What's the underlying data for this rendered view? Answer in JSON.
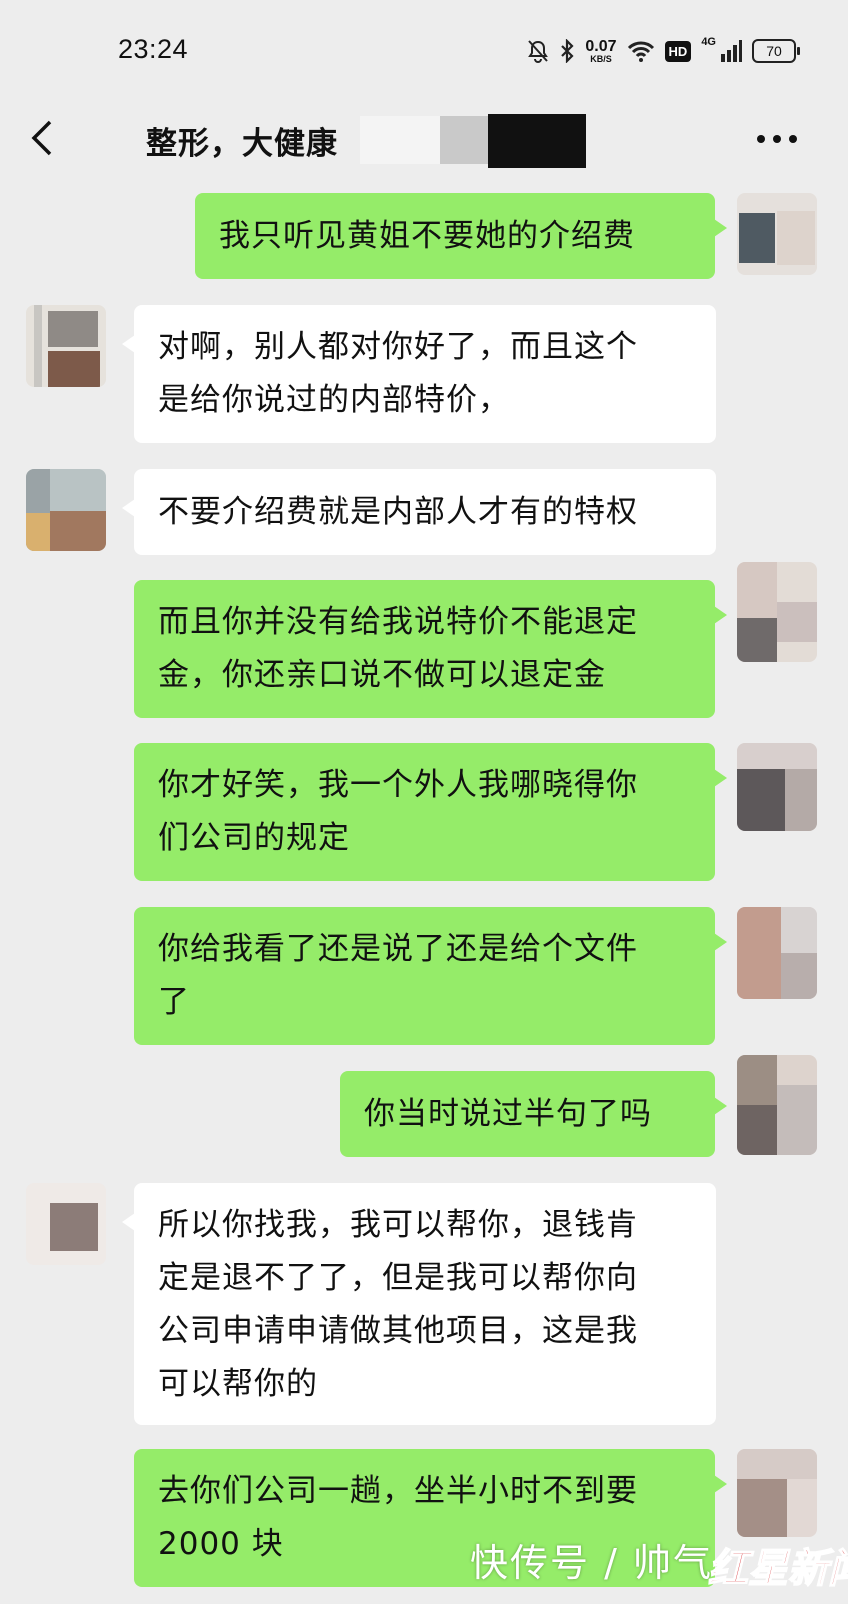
{
  "status_bar": {
    "time": "23:24",
    "net_speed_value": "0.07",
    "net_speed_unit": "KB/S",
    "hd_badge": "HD",
    "network_type": "4G",
    "battery_level": "70"
  },
  "header": {
    "title": "整形，大健康"
  },
  "messages": [
    {
      "from": "me",
      "text": "我只听见黄姐不要她的介绍费"
    },
    {
      "from": "other",
      "text": "对啊，别人都对你好了，而且这个\n是给你说过的内部特价，"
    },
    {
      "from": "other",
      "text": "不要介绍费就是内部人才有的特权"
    },
    {
      "from": "me",
      "text": "而且你并没有给我说特价不能退定\n金，你还亲口说不做可以退定金"
    },
    {
      "from": "me",
      "text": "你才好笑，我一个外人我哪晓得你\n们公司的规定"
    },
    {
      "from": "me",
      "text": "你给我看了还是说了还是给个文件\n了"
    },
    {
      "from": "me",
      "text": "你当时说过半句了吗"
    },
    {
      "from": "other",
      "text": "所以你找我，我可以帮你，退钱肯\n定是退不了了，但是我可以帮你向\n公司申请申请做其他项目，这是我\n可以帮你的"
    },
    {
      "from": "me",
      "text": "去你们公司一趟，坐半小时不到要\n2000 块"
    }
  ],
  "watermark": {
    "text": "快传号 / 帅气",
    "logo_text": "红星新闻"
  },
  "colors": {
    "background": "#ededed",
    "my_bubble": "#95ec69",
    "other_bubble": "#ffffff"
  }
}
